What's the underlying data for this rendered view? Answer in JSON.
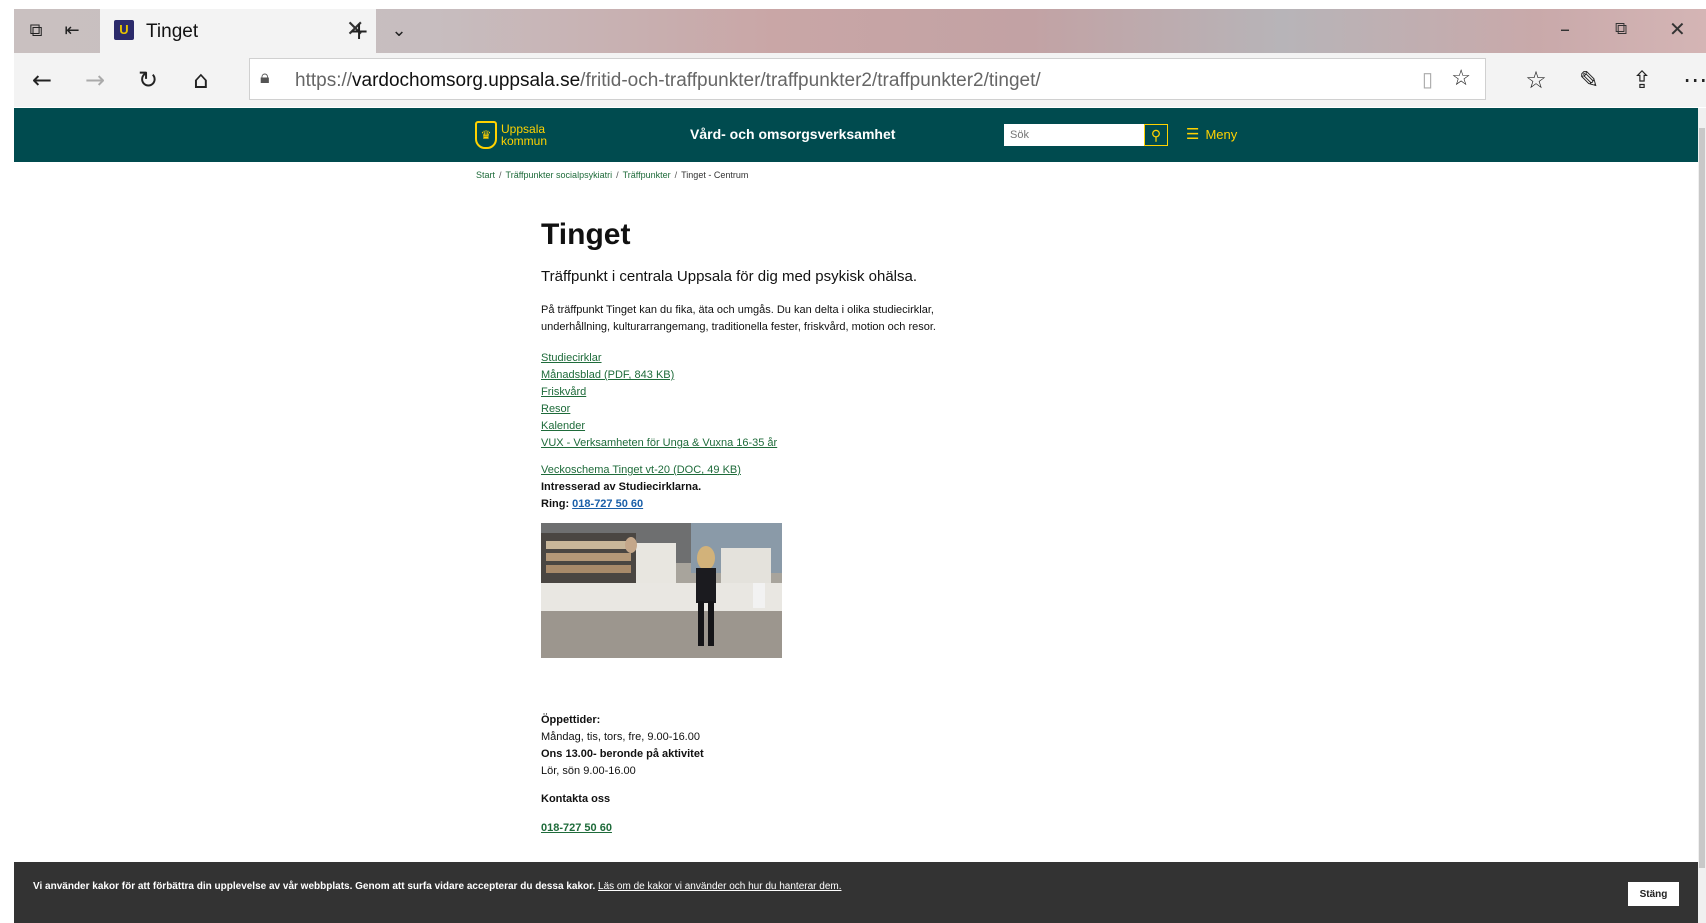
{
  "browser": {
    "tab_title": "Tinget",
    "tab_favicon": "U",
    "url_prefix": "https://",
    "url_domain": "vardochomsorg.uppsala.se",
    "url_path": "/fritid-och-traffpunkter/traffpunkter2/traffpunkter2/tinget/",
    "icons": [
      "tab-manager-icon",
      "tab-aside-icon",
      "close-icon",
      "new-tab-icon",
      "chevron-down-icon",
      "minimize-icon",
      "restore-icon",
      "window-close-icon",
      "back-icon",
      "forward-icon",
      "refresh-icon",
      "home-icon",
      "lock-icon",
      "reading-view-icon",
      "favorite-star-icon",
      "favorites-list-icon",
      "pen-icon",
      "share-icon",
      "more-icon"
    ]
  },
  "header": {
    "logo_line1": "Uppsala",
    "logo_line2": "kommun",
    "site_title": "Vård- och omsorgsverksamhet",
    "search_placeholder": "Sök",
    "menu_label": "Meny",
    "colors": {
      "background": "#004b4f",
      "accent": "#ffd200"
    }
  },
  "breadcrumb": {
    "items": [
      "Start",
      "Träffpunkter socialpsykiatri",
      "Träffpunkter"
    ],
    "current": "Tinget - Centrum"
  },
  "main": {
    "title": "Tinget",
    "lead": "Träffpunkt i centrala Uppsala för dig med psykisk ohälsa.",
    "intro_line1": "På träffpunkt Tinget kan du fika, äta och umgås. Du kan delta i olika studiecirklar,",
    "intro_line2": "underhållning, kulturarrangemang, traditionella fester, friskvård, motion och resor.",
    "links": [
      "Studiecirklar",
      "Månadsblad (PDF, 843 KB)",
      "Friskvård",
      "Resor",
      "Kalender",
      "VUX - Verksamheten för Unga & Vuxna 16-35 år"
    ],
    "schedule_link": "Veckoschema Tinget vt-20 (DOC, 49 KB)",
    "interest_text": "Intresserad av Studiecirklarna.",
    "call_label": "Ring:",
    "call_number": "018-727 50 60",
    "hours_label": "Öppettider:",
    "hours_line1": "Måndag, tis, tors, fre, 9.00-16.00",
    "hours_line2": "Ons 13.00- beronde på aktivitet",
    "hours_line3": "Lör, sön 9.00-16.00",
    "contact_head": "Kontakta oss",
    "contact_phone": "018-727 50 60"
  },
  "cookie": {
    "text": "Vi använder kakor för att förbättra din upplevelse av vår webbplats. Genom att surfa vidare accepterar du dessa kakor.",
    "link": "Läs om de kakor vi använder och hur du hanterar dem.",
    "close_label": "Stäng"
  }
}
